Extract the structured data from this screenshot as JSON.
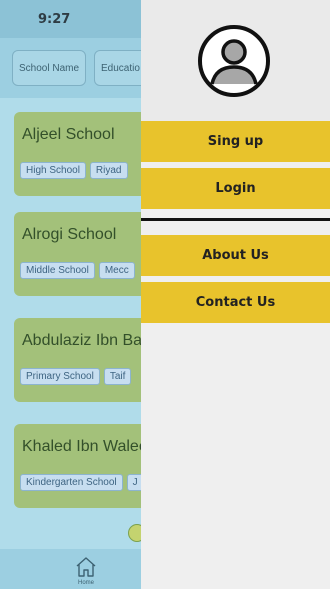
{
  "status_bar": {
    "time": "9:27"
  },
  "filters": [
    "School Name",
    "Educatio"
  ],
  "schools": [
    {
      "name": "Aljeel School",
      "tags": [
        "High School",
        "Riyad"
      ]
    },
    {
      "name": "Alrogi School",
      "tags": [
        "Middle School",
        "Mecc"
      ]
    },
    {
      "name": "Abdulaziz Ibn Baz",
      "tags": [
        "Primary School",
        "Taif"
      ]
    },
    {
      "name": "Khaled Ibn Walee",
      "tags": [
        "Kindergarten School",
        "J"
      ]
    }
  ],
  "bottom_nav": {
    "home_label": "Home"
  },
  "drawer": {
    "avatar_icon": "user-avatar-icon",
    "items": [
      {
        "label": "Sing up"
      },
      {
        "label": "Login"
      },
      {
        "label": "About Us"
      },
      {
        "label": "Contact Us"
      }
    ]
  },
  "colors": {
    "drawer_accent": "#e8c32c",
    "card_background": "#a3c17a",
    "app_background": "#b0dcea"
  }
}
